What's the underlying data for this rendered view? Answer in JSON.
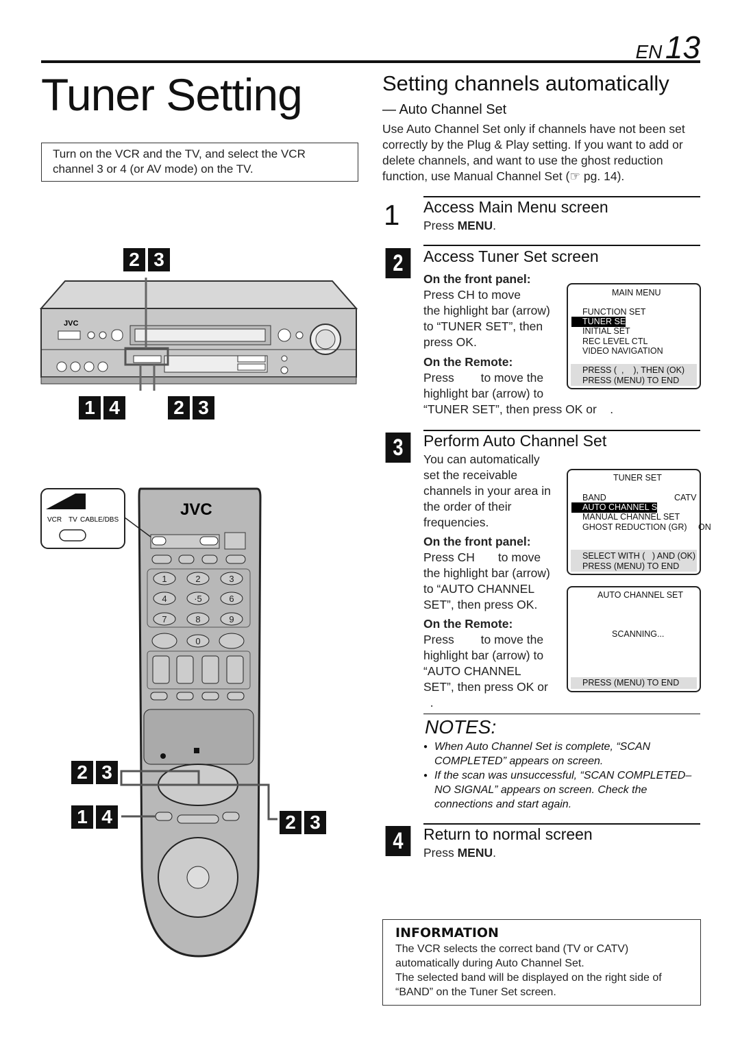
{
  "header": {
    "lang": "EN",
    "page_number": "13"
  },
  "title": "Tuner Setting",
  "intro_box": "Turn on the VCR and the TV, and select the VCR channel 3 or 4 (or AV mode) on the TV.",
  "section": {
    "title": "Setting channels automatically",
    "subtitle": "— Auto Channel Set",
    "paragraph": "Use Auto Channel Set only if channels have not been set correctly by the Plug & Play setting. If you want to add or delete channels, and want to use the ghost reduction function, use Manual Channel Set (☞ pg. 14)."
  },
  "steps": [
    {
      "number": "1",
      "heading": "Access Main Menu screen",
      "text_pre": "Press ",
      "text_bold": "MENU",
      "text_post": "."
    },
    {
      "number": "2",
      "heading": "Access Tuner Set screen",
      "front_label": "On the front panel:",
      "front_lines": [
        "Press CH       to move",
        "the highlight bar (arrow)",
        "to “TUNER SET”, then",
        "press OK."
      ],
      "remote_label": "On the Remote:",
      "remote_lines": [
        "Press        to move the",
        "highlight bar (arrow) to",
        "“TUNER SET”, then press OK or    ."
      ]
    },
    {
      "number": "3",
      "heading": "Perform Auto Channel Set",
      "intro_lines": [
        "You can automatically",
        "set the receivable",
        "channels in your area in",
        "the order of their",
        "frequencies."
      ],
      "front_label": "On the front panel:",
      "front_lines": [
        "Press CH       to move",
        "the highlight bar (arrow)",
        "to “AUTO CHANNEL",
        "SET”, then press OK."
      ],
      "remote_label": "On the Remote:",
      "remote_lines": [
        "Press        to move the",
        "highlight bar (arrow) to",
        "“AUTO CHANNEL",
        "SET”, then press OK or",
        "  ."
      ]
    },
    {
      "number": "4",
      "heading": "Return to normal screen",
      "text_pre": "Press ",
      "text_bold": "MENU",
      "text_post": "."
    }
  ],
  "screens": {
    "main_menu": {
      "title": "MAIN MENU",
      "items": [
        "FUNCTION SET",
        "TUNER SE",
        "INITIAL SET",
        "REC LEVEL CTL",
        "VIDEO NAVIGATION"
      ],
      "footer": [
        "PRESS (  ,    ), THEN (OK)",
        "PRESS (MENU) TO END"
      ]
    },
    "tuner_set": {
      "title": "TUNER SET",
      "band_label": "BAND",
      "band_value": "CATV",
      "items": [
        "AUTO CHANNEL S",
        "MANUAL CHANNEL SET",
        "GHOST REDUCTION (GR)"
      ],
      "gr_value": "ON",
      "footer": [
        "SELECT WITH (   ) AND (OK)",
        "PRESS (MENU) TO END"
      ]
    },
    "auto_channel": {
      "title": "AUTO CHANNEL SET",
      "status": "SCANNING...",
      "footer": "PRESS (MENU) TO END"
    }
  },
  "notes": {
    "title": "NOTES:",
    "items": [
      "When Auto Channel Set is complete, “SCAN COMPLETED” appears on screen.",
      "If the scan was unsuccessful, “SCAN COMPLETED– NO SIGNAL” appears on screen. Check the connections and start again."
    ]
  },
  "information": {
    "title": "INFORMATION",
    "lines": [
      "The VCR selects the correct band (TV or CATV) automatically during Auto Channel Set.",
      "The selected band will be displayed on the right side of “BAND” on the Tuner Set screen."
    ]
  },
  "illustration": {
    "brand": "JVC",
    "switch_labels": [
      "VCR",
      "TV",
      "CABLE/DBS"
    ],
    "keypad": [
      "1",
      "2",
      "3",
      "4",
      "·5",
      "6",
      "7",
      "8",
      "9",
      "0"
    ],
    "labels": {
      "vcr_top": [
        "2",
        "3"
      ],
      "vcr_left": [
        "1",
        "4"
      ],
      "vcr_right": [
        "2",
        "3"
      ],
      "remote_a": [
        "2",
        "3"
      ],
      "remote_b": [
        "1",
        "4"
      ],
      "remote_c": [
        "2",
        "3"
      ]
    }
  }
}
